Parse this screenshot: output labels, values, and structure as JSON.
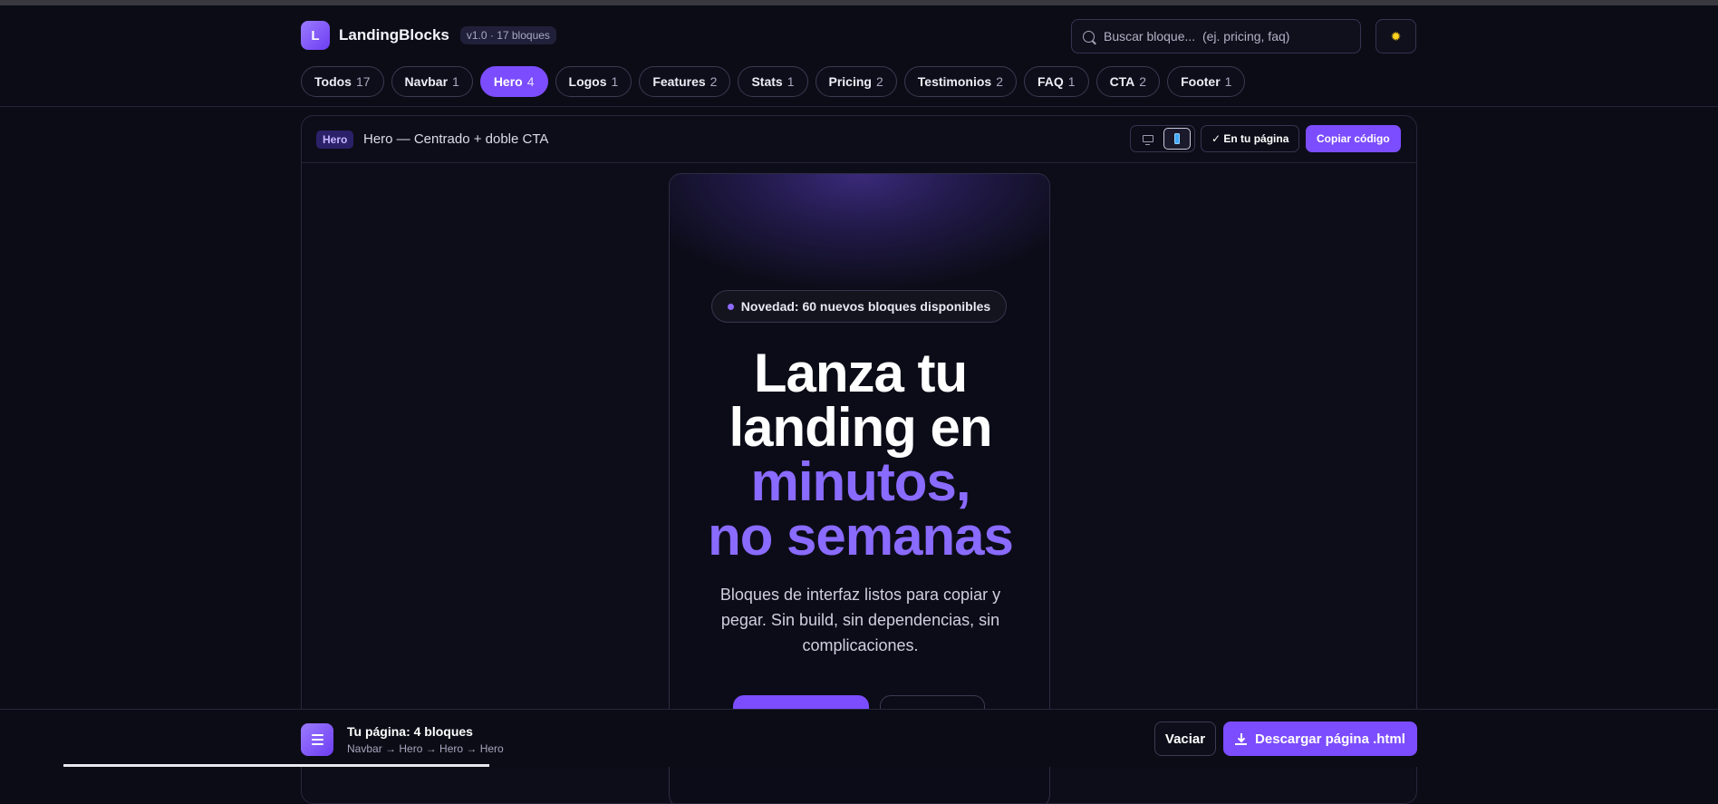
{
  "header": {
    "brand_initial": "L",
    "brand_name": "LandingBlocks",
    "version": "v1.0 · 17 bloques",
    "search_placeholder": "Buscar bloque...  (ej. pricing, faq)",
    "theme_icon": "sun-icon"
  },
  "chips": [
    {
      "label": "Todos",
      "count": "17",
      "active": false
    },
    {
      "label": "Navbar",
      "count": "1",
      "active": false
    },
    {
      "label": "Hero",
      "count": "4",
      "active": true
    },
    {
      "label": "Logos",
      "count": "1",
      "active": false
    },
    {
      "label": "Features",
      "count": "2",
      "active": false
    },
    {
      "label": "Stats",
      "count": "1",
      "active": false
    },
    {
      "label": "Pricing",
      "count": "2",
      "active": false
    },
    {
      "label": "Testimonios",
      "count": "2",
      "active": false
    },
    {
      "label": "FAQ",
      "count": "1",
      "active": false
    },
    {
      "label": "CTA",
      "count": "2",
      "active": false
    },
    {
      "label": "Footer",
      "count": "1",
      "active": false
    }
  ],
  "preview": {
    "tag": "Hero",
    "title": "Hero — Centrado + doble CTA",
    "on_page_label": "✓ En tu página",
    "copy_label": "Copiar código",
    "view_mode": "mobile",
    "hero": {
      "badge": "Novedad: 60 nuevos bloques disponibles",
      "line1": "Lanza tu",
      "line2": "landing en",
      "line3": "minutos,",
      "line4": "no semanas",
      "subtext": "Bloques de interfaz listos para copiar y pegar. Sin build, sin dependencias, sin complicaciones."
    }
  },
  "footer": {
    "title": "Tu página: 4 bloques",
    "crumbs": "Navbar → Hero → Hero → Hero",
    "clear_label": "Vaciar",
    "download_label": "Descargar página .html"
  },
  "colors": {
    "accent": "#7c4dff",
    "accent_text": "#8a6bff",
    "background": "#0c0c17"
  }
}
